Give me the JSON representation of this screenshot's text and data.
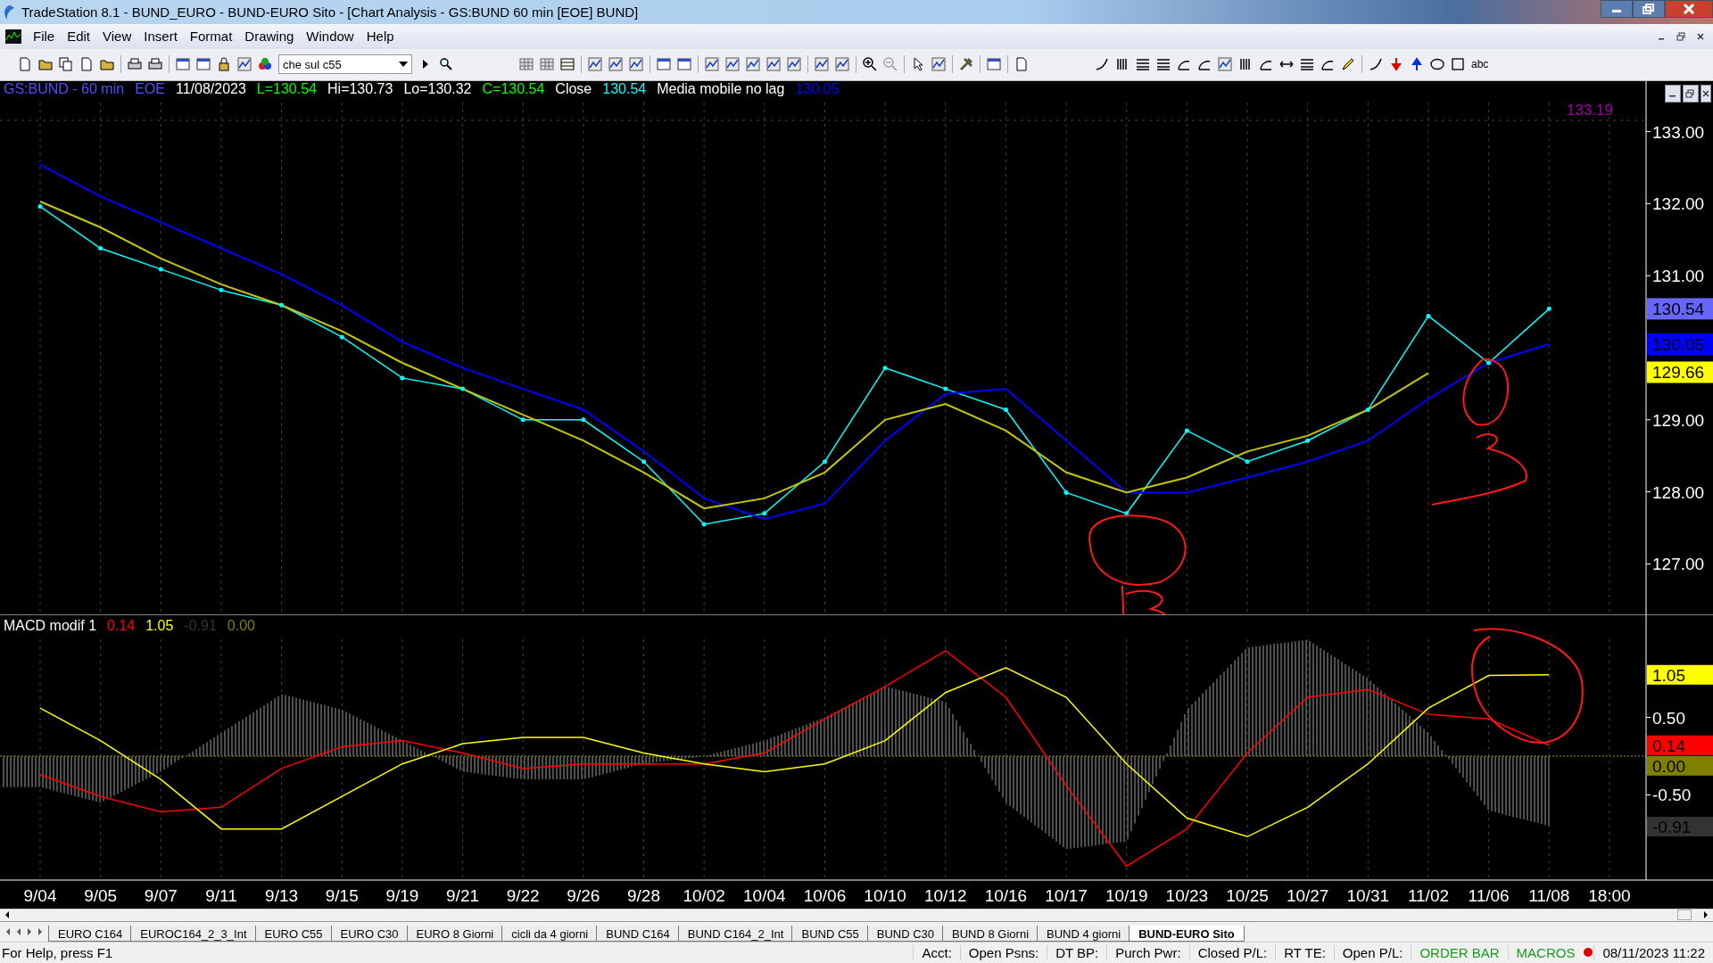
{
  "window": {
    "title": "TradeStation 8.1 - BUND_EURO - BUND-EURO Sito - [Chart Analysis - GS:BUND  60 min  [EOE] BUND]"
  },
  "menu": [
    "File",
    "Edit",
    "View",
    "Insert",
    "Format",
    "Drawing",
    "Window",
    "Help"
  ],
  "toolbar": {
    "workspace_combo": "che sul c55",
    "text_tool": "abc"
  },
  "price_pane": {
    "legend": [
      {
        "text": "GS:BUND - 60 min",
        "color": "#5050ff"
      },
      {
        "text": "EOE",
        "color": "#5050ff"
      },
      {
        "text": "11/08/2023",
        "color": "#ffffff"
      },
      {
        "text": "L=130.54",
        "color": "#00ff00"
      },
      {
        "text": "Hi=130.73",
        "color": "#ffffff"
      },
      {
        "text": "Lo=130.32",
        "color": "#ffffff"
      },
      {
        "text": "C=130.54",
        "color": "#00ff00"
      },
      {
        "text": "Close",
        "color": "#ffffff"
      },
      {
        "text": "130.54",
        "color": "#00ffff"
      },
      {
        "text": "Media mobile no lag",
        "color": "#ffffff"
      },
      {
        "text": "130.05",
        "color": "#0000ff"
      }
    ],
    "top_value": "133.19",
    "markers": [
      {
        "text": "130.54",
        "color": "#6666ff"
      },
      {
        "text": "130.05",
        "color": "#0000ff"
      },
      {
        "text": "129.66",
        "color": "#ffff00"
      }
    ],
    "chart_data": {
      "type": "line",
      "ylim": [
        126.3,
        133.7
      ],
      "grid": true,
      "yticks": [
        {
          "value": 127,
          "label": "127.00"
        },
        {
          "value": 128,
          "label": "128.00"
        },
        {
          "value": 129,
          "label": "129.00"
        },
        {
          "value": 131,
          "label": "131.00"
        },
        {
          "value": 132,
          "label": "132.00"
        },
        {
          "value": 133,
          "label": "133.00"
        }
      ],
      "series": [
        {
          "color": "#00ffff",
          "values": [
            131.96,
            131.38,
            131.09,
            130.8,
            130.59,
            130.15,
            129.58,
            129.43,
            129.0,
            129.0,
            128.42,
            127.55,
            127.7,
            128.42,
            129.72,
            129.43,
            129.14,
            127.99,
            127.7,
            128.85,
            128.42,
            128.71,
            129.14,
            130.44,
            129.79,
            130.54,
            null
          ]
        },
        {
          "color": "#0000ff",
          "values": [
            132.54,
            132.1,
            131.74,
            131.38,
            131.02,
            130.59,
            130.08,
            129.72,
            129.43,
            129.14,
            128.56,
            127.91,
            127.62,
            127.84,
            128.71,
            129.36,
            129.43,
            128.71,
            127.99,
            127.99,
            128.2,
            128.42,
            128.71,
            129.29,
            129.79,
            130.05,
            null
          ]
        },
        {
          "color": "#c8c800",
          "values": [
            132.03,
            131.67,
            131.24,
            130.88,
            130.59,
            130.23,
            129.79,
            129.43,
            129.07,
            128.71,
            128.27,
            127.77,
            127.91,
            128.27,
            129.0,
            129.22,
            128.85,
            128.27,
            127.99,
            128.2,
            128.56,
            128.78,
            129.14,
            129.65,
            null,
            null,
            null
          ]
        }
      ]
    }
  },
  "macd_pane": {
    "legend": [
      {
        "text": "MACD modif 1",
        "color": "#ffffff"
      },
      {
        "text": "0.14",
        "color": "#ff0000"
      },
      {
        "text": "1.05",
        "color": "#ffff00"
      },
      {
        "text": "-0.91",
        "color": "#333333"
      },
      {
        "text": "0.00",
        "color": "#808000"
      }
    ],
    "markers": [
      {
        "text": "1.05",
        "color": "#ffff00"
      },
      {
        "text": "0.14",
        "color": "#ff0000"
      },
      {
        "text": "0.00",
        "color": "#808000"
      },
      {
        "text": "-0.91",
        "color": "#333333"
      }
    ],
    "chart_data": {
      "type": "line",
      "ylim": [
        -1.6,
        1.83
      ],
      "grid": true,
      "categories": [
        "9/04",
        "9/05",
        "9/07",
        "9/11",
        "9/13",
        "9/15",
        "9/19",
        "9/21",
        "9/22",
        "9/26",
        "9/28",
        "10/02",
        "10/04",
        "10/06",
        "10/10",
        "10/12",
        "10/16",
        "10/17",
        "10/19",
        "10/23",
        "10/25",
        "10/27",
        "10/31",
        "11/02",
        "11/06",
        "11/08",
        "18:00"
      ],
      "yticks": [
        {
          "value": 0.5,
          "label": "0.50"
        },
        {
          "value": -0.5,
          "label": "-0.50"
        }
      ],
      "series": [
        {
          "color": "#ff0000",
          "values": [
            -0.24,
            -0.52,
            -0.72,
            -0.66,
            -0.16,
            0.12,
            0.2,
            0.04,
            -0.16,
            -0.1,
            -0.1,
            -0.1,
            0.04,
            0.48,
            0.9,
            1.36,
            0.76,
            -0.38,
            -1.42,
            -0.94,
            0.04,
            0.76,
            0.86,
            0.54,
            0.48,
            0.14,
            null
          ]
        },
        {
          "color": "#ffff00",
          "values": [
            0.62,
            0.2,
            -0.3,
            -0.94,
            -0.94,
            -0.52,
            -0.1,
            0.16,
            0.24,
            0.24,
            0.04,
            -0.1,
            -0.2,
            -0.1,
            0.2,
            0.82,
            1.14,
            0.76,
            -0.1,
            -0.8,
            -1.04,
            -0.66,
            -0.1,
            0.62,
            1.04,
            1.05,
            null
          ]
        }
      ]
    }
  },
  "sheet_tabs": [
    {
      "label": "EURO C164",
      "selected": false
    },
    {
      "label": "EUROC164_2_3_Int",
      "selected": false
    },
    {
      "label": "EURO C55",
      "selected": false
    },
    {
      "label": "EURO C30",
      "selected": false
    },
    {
      "label": "EURO 8 Giorni",
      "selected": false
    },
    {
      "label": "cicli da 4 giorni",
      "selected": false
    },
    {
      "label": "BUND C164",
      "selected": false
    },
    {
      "label": "BUND C164_2_Int",
      "selected": false
    },
    {
      "label": "BUND C55",
      "selected": false
    },
    {
      "label": "BUND  C30",
      "selected": false
    },
    {
      "label": "BUND 8 Giorni",
      "selected": false
    },
    {
      "label": "BUND 4 giorni",
      "selected": false
    },
    {
      "label": "BUND-EURO Sito",
      "selected": true
    }
  ],
  "status_bar": {
    "help": "For Help, press F1",
    "fields": [
      {
        "text": "Acct:",
        "kind": "label"
      },
      {
        "text": "Open Psns:",
        "kind": "label"
      },
      {
        "text": "DT BP:",
        "kind": "label"
      },
      {
        "text": "Purch Pwr:",
        "kind": "label"
      },
      {
        "text": "Closed P/L:",
        "kind": "label"
      },
      {
        "text": "RT TE:",
        "kind": "label"
      },
      {
        "text": "Open P/L:",
        "kind": "label"
      },
      {
        "text": "ORDER BAR",
        "kind": "link"
      },
      {
        "text": "MACROS",
        "kind": "link"
      }
    ],
    "datetime": "08/11/2023 11:22"
  }
}
